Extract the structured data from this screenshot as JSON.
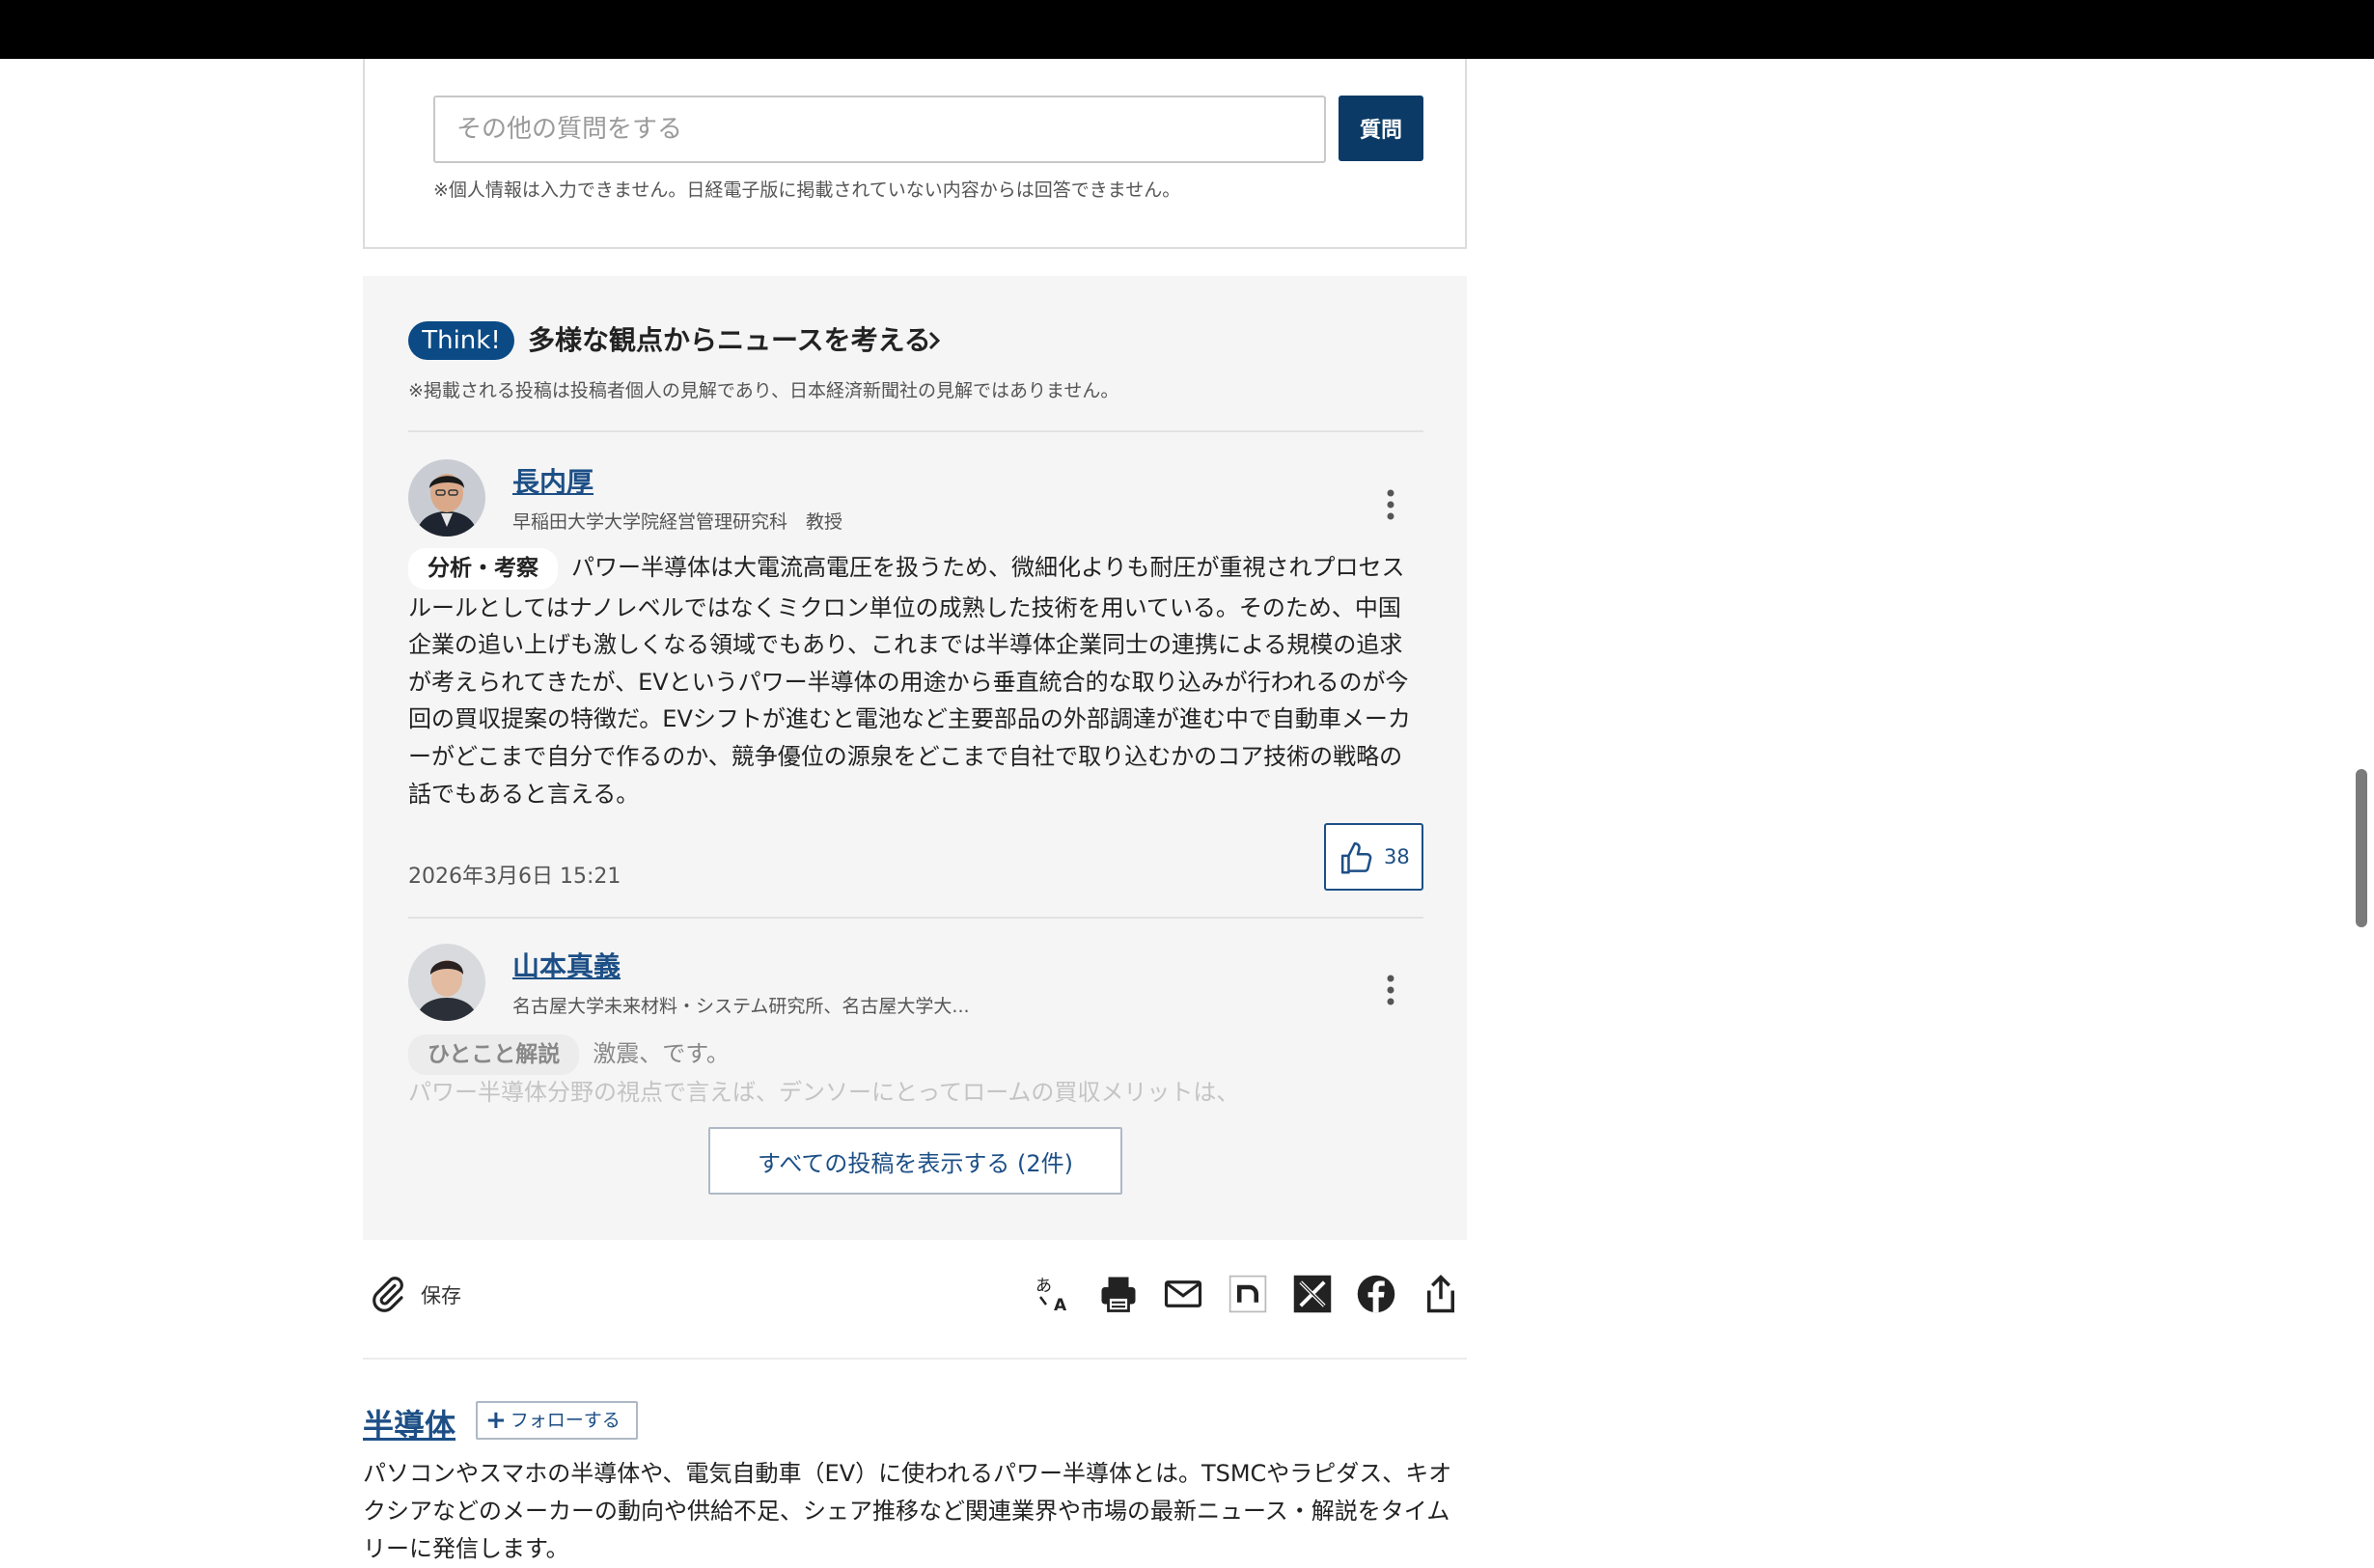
{
  "question": {
    "placeholder": "その他の質問をする",
    "submit_label": "質問",
    "note": "※個人情報は入力できません。日経電子版に掲載されていない内容からは回答できません。"
  },
  "think": {
    "badge": "Think!",
    "title": "多様な観点からニュースを考える",
    "note": "※掲載される投稿は投稿者個人の見解であり、日本経済新聞社の見解ではありません。",
    "posts": [
      {
        "name": "長内厚",
        "affiliation": "早稲田大学大学院経営管理研究科　教授",
        "tag": "分析・考察",
        "body": "パワー半導体は大電流高電圧を扱うため、微細化よりも耐圧が重視されプロセスルールとしてはナノレベルではなくミクロン単位の成熟した技術を用いている。そのため、中国企業の追い上げも激しくなる領域でもあり、これまでは半導体企業同士の連携による規模の追求が考えられてきたが、EVというパワー半導体の用途から垂直統合的な取り込みが行われるのが今回の買収提案の特徴だ。EVシフトが進むと電池など主要部品の外部調達が進む中で自動車メーカーがどこまで自分で作るのか、競争優位の源泉をどこまで自社で取り込むかのコア技術の戦略の話でもあると言える。",
        "date": "2026年3月6日 15:21",
        "likes": "38"
      },
      {
        "name": "山本真義",
        "affiliation": "名古屋大学未来材料・システム研究所、名古屋大学大...",
        "tag": "ひとこと解説",
        "body_line1": "激震、です。",
        "body_line2": "パワー半導体分野の視点で言えば、デンソーにとってロームの買収メリットは、"
      }
    ],
    "show_all_label": "すべての投稿を表示する (2件)"
  },
  "toolbar": {
    "save_label": "保存",
    "icons": [
      "translate-icon",
      "print-icon",
      "mail-icon",
      "note-icon",
      "x-icon",
      "facebook-icon",
      "share-icon"
    ]
  },
  "topic": {
    "title": "半導体",
    "follow_label": "フォローする",
    "description": "パソコンやスマホの半導体や、電気自動車（EV）に使われるパワー半導体とは。TSMCやラピダス、キオクシアなどのメーカーの動向や供給不足、シェア推移など関連業界や市場の最新ニュース・解説をタイムリーに発信します。"
  },
  "colors": {
    "brand_navy": "#0b3a66",
    "link_blue": "#1d4f86",
    "panel_bg": "#f5f5f5"
  }
}
